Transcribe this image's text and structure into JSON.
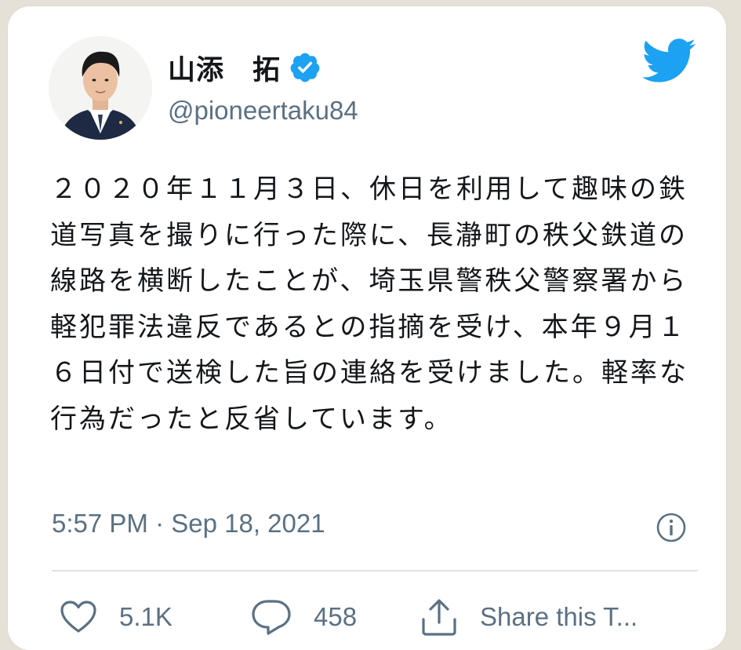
{
  "tweet": {
    "author": {
      "name": "山添　拓",
      "handle": "@pioneertaku84",
      "verified": true
    },
    "text": "２０２０年１１月３日、休日を利用して趣味の鉄道写真を撮りに行った際に、長瀞町の秩父鉄道の線路を横断したことが、埼玉県警秩父警察署から軽犯罪法違反であるとの指摘を受け、本年９月１６日付で送検した旨の連絡を受けました。軽率な行為だったと反省しています。",
    "timestamp": "5:57 PM · Sep 18, 2021",
    "likes": "5.1K",
    "replies": "458",
    "share_label": "Share this T..."
  },
  "colors": {
    "twitter_blue": "#1da1f2",
    "text_primary": "#14171a",
    "text_secondary": "#5b7083"
  },
  "icons": {
    "logo": "twitter-bird-icon",
    "verified": "verified-badge-icon",
    "info": "info-icon",
    "like": "heart-icon",
    "reply": "reply-bubble-icon",
    "share": "share-icon"
  }
}
